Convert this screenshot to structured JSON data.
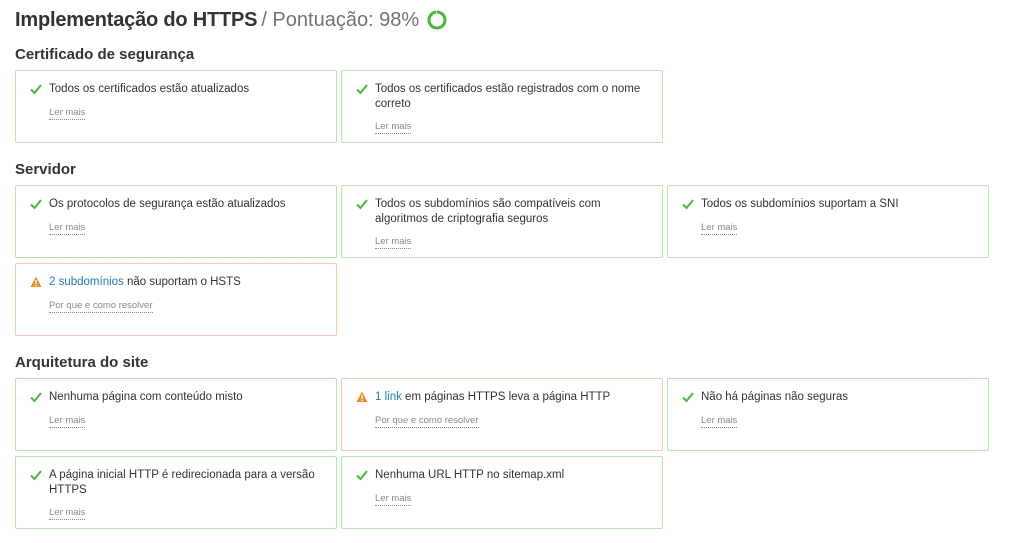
{
  "header": {
    "title": "Implementação do HTTPS",
    "score_text": "/ Pontuação: 98%",
    "score_value": 98,
    "ring_color": "#4cb83d"
  },
  "sections": {
    "certificate": {
      "title": "Certificado de segurança",
      "cards": [
        {
          "status": "ok",
          "text": "Todos os certificados estão atualizados",
          "more": "Ler mais"
        },
        {
          "status": "ok",
          "text": "Todos os certificados estão registrados com o nome correto",
          "more": "Ler mais"
        }
      ]
    },
    "server": {
      "title": "Servidor",
      "cards": [
        {
          "status": "ok",
          "text": "Os protocolos de segurança estão atualizados",
          "more": "Ler mais"
        },
        {
          "status": "ok",
          "text": "Todos os subdomínios são compatíveis com algoritmos de criptografia seguros",
          "more": "Ler mais"
        },
        {
          "status": "ok",
          "text": "Todos os subdomínios suportam a SNI",
          "more": "Ler mais"
        },
        {
          "status": "warning",
          "link": "2 subdomínios",
          "text": " não suportam o HSTS",
          "more": "Por que e como resolver"
        }
      ]
    },
    "architecture": {
      "title": "Arquitetura do site",
      "cards": [
        {
          "status": "ok",
          "text": "Nenhuma página com conteúdo misto",
          "more": "Ler mais"
        },
        {
          "status": "warning",
          "link": "1 link",
          "text": " em páginas HTTPS leva a página HTTP",
          "more": "Por que e como resolver"
        },
        {
          "status": "ok",
          "text": "Não há páginas não seguras",
          "more": "Ler mais"
        },
        {
          "status": "ok",
          "text": "A página inicial HTTP é redirecionada para a versão HTTPS",
          "more": "Ler mais"
        },
        {
          "status": "ok",
          "text": "Nenhuma URL HTTP no sitemap.xml",
          "more": "Ler mais"
        }
      ]
    }
  },
  "colors": {
    "ok": "#4cb83d",
    "warning": "#f08a24",
    "link": "#1a7bbd"
  }
}
